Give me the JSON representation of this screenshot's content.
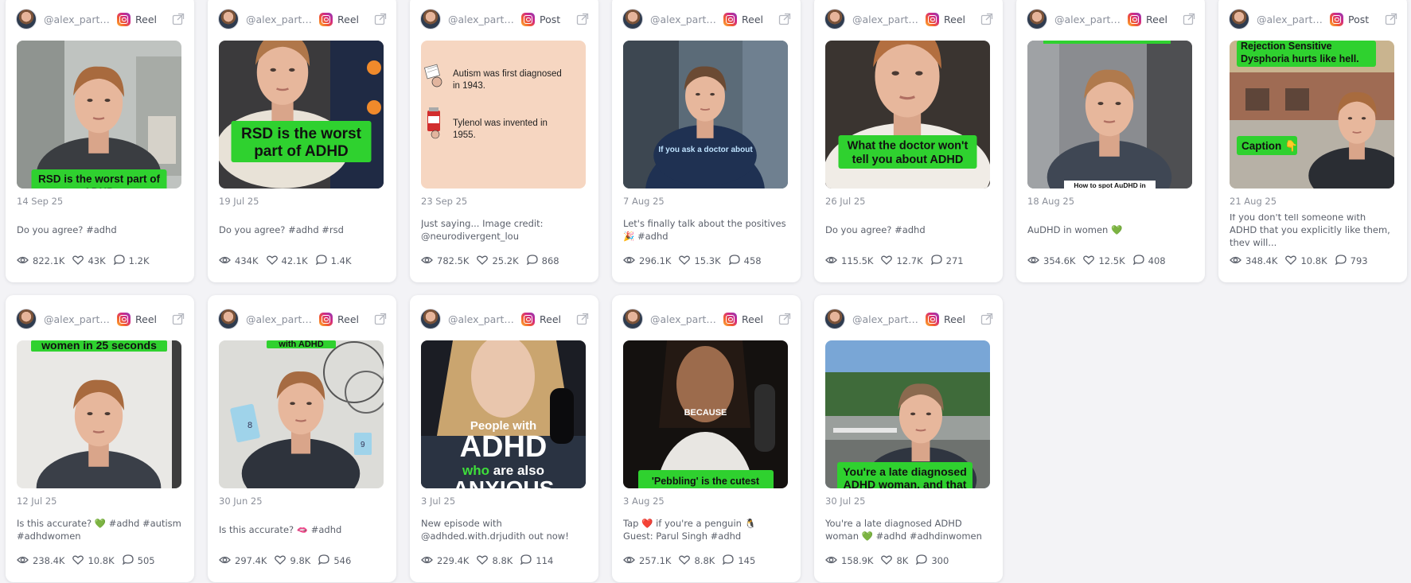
{
  "posts": [
    {
      "username": "@alex_partrid...",
      "type": "Reel",
      "date": "14 Sep 25",
      "caption": "Do you agree? #adhd",
      "views": "822.1K",
      "likes": "43K",
      "comments": "1.2K",
      "overlay": "RSD is the worst part of ADHD",
      "scene": "car"
    },
    {
      "username": "@alex_partrid...",
      "type": "Reel",
      "date": "19 Jul 25",
      "caption": "Do you agree? #adhd #rsd",
      "views": "434K",
      "likes": "42.1K",
      "comments": "1.4K",
      "overlay": "RSD is the worst part of ADHD",
      "scene": "studio"
    },
    {
      "username": "@alex_partrid...",
      "type": "Post",
      "date": "23 Sep 25",
      "caption": "Just saying... Image credit: @neurodivergent_lou",
      "views": "782.5K",
      "likes": "25.2K",
      "comments": "868",
      "overlay_lines": [
        "Autism was first diagnosed in 1943.",
        "Tylenol was invented in 1955."
      ],
      "scene": "text-post"
    },
    {
      "username": "@alex_partrid...",
      "type": "Reel",
      "date": "7 Aug 25",
      "caption": "Let's finally talk about the positives 🎉 #adhd",
      "views": "296.1K",
      "likes": "15.3K",
      "comments": "458",
      "overlay": "If you ask a doctor about",
      "scene": "suit"
    },
    {
      "username": "@alex_partrid...",
      "type": "Reel",
      "date": "26 Jul 25",
      "caption": "Do you agree? #adhd",
      "views": "115.5K",
      "likes": "12.7K",
      "comments": "271",
      "overlay": "What the doctor won't tell you about ADHD",
      "scene": "closeup"
    },
    {
      "username": "@alex_partrid...",
      "type": "Reel",
      "date": "18 Aug 25",
      "caption": "AuDHD in women 💚",
      "views": "354.6K",
      "likes": "12.5K",
      "comments": "408",
      "overlay": "How to spot AuDHD in",
      "scene": "room"
    },
    {
      "username": "@alex_partrid...",
      "type": "Post",
      "date": "21 Aug 25",
      "caption": "If you don't tell someone with ADHD that you explicitly like them, they will...",
      "views": "348.4K",
      "likes": "10.8K",
      "comments": "793",
      "overlay": "Rejection Sensitive Dysphoria hurts like hell.",
      "overlay2": "Caption 👇",
      "scene": "station"
    },
    {
      "username": "@alex_partrid...",
      "type": "Reel",
      "date": "12 Jul 25",
      "caption": "Is this accurate? 💚 #adhd #autism #adhdwomen",
      "views": "238.4K",
      "likes": "10.8K",
      "comments": "505",
      "overlay": "women in 25 seconds",
      "scene": "wall"
    },
    {
      "username": "@alex_partrid...",
      "type": "Reel",
      "date": "30 Jun 25",
      "caption": "Is this accurate? 🫦 #adhd",
      "views": "297.4K",
      "likes": "9.8K",
      "comments": "546",
      "overlay": "with ADHD",
      "scene": "notes"
    },
    {
      "username": "@alex_partrid...",
      "type": "Reel",
      "date": "3 Jul 25",
      "caption": "New episode with @adhded.with.drjudith out now!",
      "views": "229.4K",
      "likes": "8.8K",
      "comments": "114",
      "overlay_lines": [
        "People with",
        "ADHD",
        "who are also",
        "ANXIOUS"
      ],
      "scene": "podcast"
    },
    {
      "username": "@alex_partrid...",
      "type": "Reel",
      "date": "3 Aug 25",
      "caption": "Tap ❤️ if you're a penguin 🐧 Guest: Parul Singh #adhd",
      "views": "257.1K",
      "likes": "8.8K",
      "comments": "145",
      "overlay": "'Pebbling' is the cutest",
      "overlay2": "BECAUSE",
      "scene": "guest"
    },
    {
      "username": "@alex_partrid...",
      "type": "Reel",
      "date": "30 Jul 25",
      "caption": "You're a late diagnosed ADHD woman 💚 #adhd #adhdinwomen",
      "views": "158.9K",
      "likes": "8K",
      "comments": "300",
      "overlay": "You're a late diagnosed ADHD woman, and that",
      "scene": "outdoor"
    }
  ],
  "colors": {
    "overlay_green": "#2fd12f",
    "accent_text": "#2b2f3a"
  }
}
